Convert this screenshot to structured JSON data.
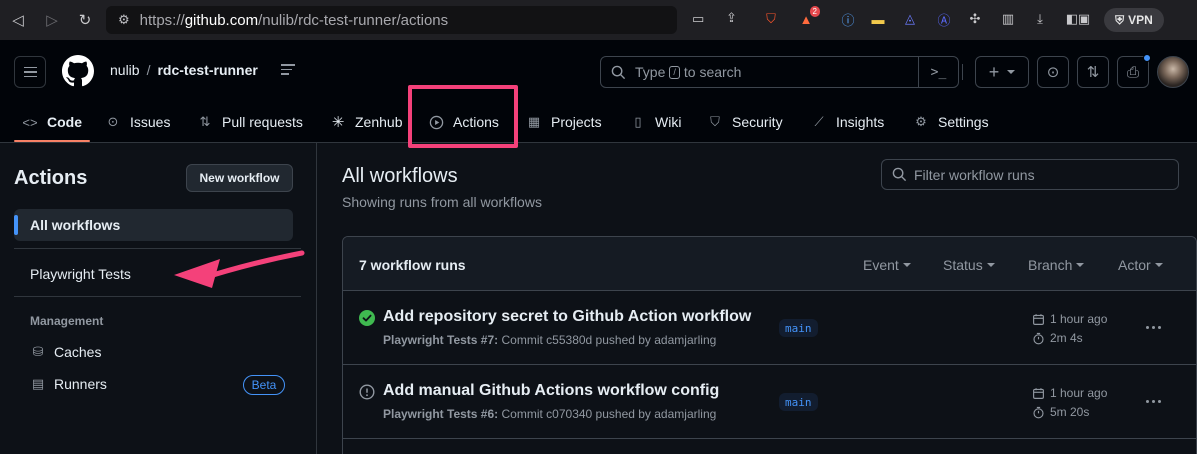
{
  "browser": {
    "url_scheme": "https://",
    "url_host": "github.com",
    "url_path": "/nulib/rdc-test-runner/actions",
    "notification_count": "2",
    "vpn_label": "VPN"
  },
  "header": {
    "owner": "nulib",
    "separator": "/",
    "repo": "rdc-test-runner",
    "search_pre": "Type",
    "search_key": "/",
    "search_post": "to search"
  },
  "tabs": [
    {
      "label": "Code",
      "icon": "code-icon"
    },
    {
      "label": "Issues",
      "icon": "issue-icon"
    },
    {
      "label": "Pull requests",
      "icon": "pull-request-icon"
    },
    {
      "label": "Zenhub",
      "icon": "zenhub-icon"
    },
    {
      "label": "Actions",
      "icon": "play-icon"
    },
    {
      "label": "Projects",
      "icon": "table-icon"
    },
    {
      "label": "Wiki",
      "icon": "book-icon"
    },
    {
      "label": "Security",
      "icon": "shield-icon"
    },
    {
      "label": "Insights",
      "icon": "graph-icon"
    },
    {
      "label": "Settings",
      "icon": "gear-icon"
    }
  ],
  "sidebar": {
    "title": "Actions",
    "new_workflow": "New workflow",
    "all_workflows": "All workflows",
    "workflows": [
      "Playwright Tests"
    ],
    "management_label": "Management",
    "caches": "Caches",
    "runners": "Runners",
    "beta": "Beta"
  },
  "main": {
    "title": "All workflows",
    "subtitle": "Showing runs from all workflows",
    "filter_placeholder": "Filter workflow runs",
    "runs_count": "7 workflow runs",
    "filters": [
      "Event",
      "Status",
      "Branch",
      "Actor"
    ],
    "runs": [
      {
        "status": "success",
        "title": "Add repository secret to Github Action workflow",
        "workflow": "Playwright Tests #7:",
        "detail": "Commit c55380d pushed by adamjarling",
        "branch": "main",
        "time": "1 hour ago",
        "duration": "2m 4s"
      },
      {
        "status": "neutral",
        "title": "Add manual Github Actions workflow config",
        "workflow": "Playwright Tests #6:",
        "detail": "Commit c070340 pushed by adamjarling",
        "branch": "main",
        "time": "1 hour ago",
        "duration": "5m 20s"
      }
    ]
  },
  "colors": {
    "accent_highlight": "#f4417a",
    "success": "#3fb950",
    "link": "#4493f8",
    "tab_underline": "#f78166"
  }
}
